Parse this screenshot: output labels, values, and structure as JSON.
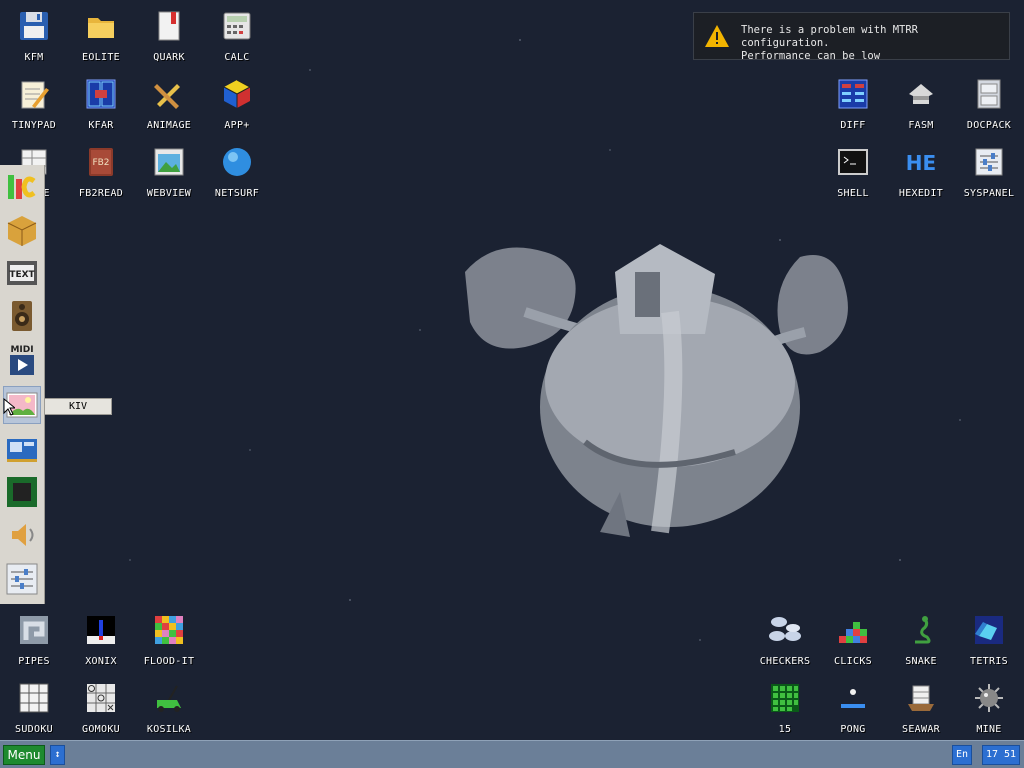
{
  "notification": {
    "line1": "There is a problem with MTRR configuration.",
    "line2": "Performance can be low",
    "icon": "warning-icon",
    "accent": "#f2b400"
  },
  "desktop_icons": {
    "kfm": "KFM",
    "eolite": "EOLITE",
    "quark": "QUARK",
    "calc": "CALC",
    "tinypad": "TINYPAD",
    "kfar": "KFAR",
    "animage": "ANIMAGE",
    "app_plus": "APP+",
    "table": "TABLE",
    "fb2read": "FB2READ",
    "webview": "WEBVIEW",
    "netsurf": "NETSURF",
    "diff": "DIFF",
    "fasm": "FASM",
    "docpack": "DOCPACK",
    "shell": "SHELL",
    "hexedit": "HEXEDIT",
    "syspanel": "SYSPANEL",
    "pipes": "PIPES",
    "xonix": "XONIX",
    "flood_it": "FLOOD-IT",
    "sudoku": "SUDOKU",
    "gomoku": "GOMOKU",
    "kosilka": "KOSILKA",
    "checkers": "CHECKERS",
    "clicks": "CLICKS",
    "snake": "SNAKE",
    "tetris": "TETRIS",
    "fifteen": "15",
    "pong": "PONG",
    "seawar": "SEAWAR",
    "mine": "MINE",
    "hexedit_glyph": "HE"
  },
  "side_panel": {
    "items": [
      "irc-icon",
      "package-icon",
      "text-editor-icon",
      "speaker-icon",
      "midi-player-icon",
      "kiv-image-viewer-icon",
      "network-card-icon",
      "cpu-chip-icon",
      "volume-icon",
      "settings-sliders-icon"
    ],
    "tooltip": "KIV",
    "text_glyph": "TEXT",
    "midi_glyph": "MIDI"
  },
  "taskbar": {
    "menu_label": "Menu",
    "switch_glyph": "↕",
    "language": "En",
    "clock": "17 51",
    "menu_color": "#1e8a2f",
    "tray_color": "#2c6fd1"
  },
  "fb2_glyph": "FB2"
}
